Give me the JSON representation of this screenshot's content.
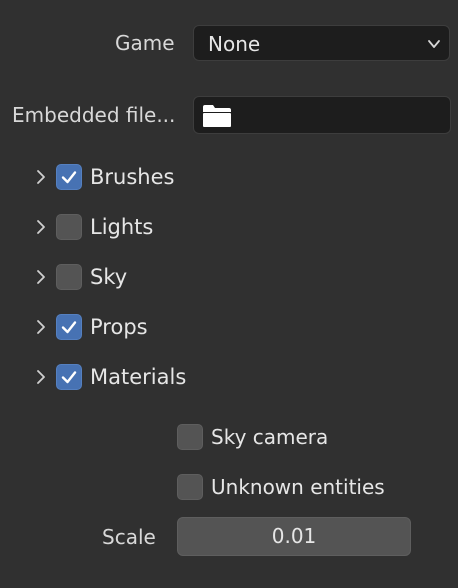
{
  "game": {
    "label": "Game",
    "value": "None",
    "chevron_icon": "chevron-down-icon"
  },
  "embedded": {
    "label": "Embedded file...",
    "folder_icon": "folder-icon"
  },
  "categories": [
    {
      "label": "Brushes",
      "checked": true
    },
    {
      "label": "Lights",
      "checked": false
    },
    {
      "label": "Sky",
      "checked": false
    },
    {
      "label": "Props",
      "checked": true
    },
    {
      "label": "Materials",
      "checked": true
    }
  ],
  "options": [
    {
      "label": "Sky camera",
      "checked": false
    },
    {
      "label": "Unknown entities",
      "checked": false
    }
  ],
  "scale": {
    "label": "Scale",
    "value": "0.01"
  },
  "colors": {
    "background": "#303030",
    "checked": "#4772b3",
    "unchecked": "#545454",
    "field": "#1d1d1d"
  }
}
